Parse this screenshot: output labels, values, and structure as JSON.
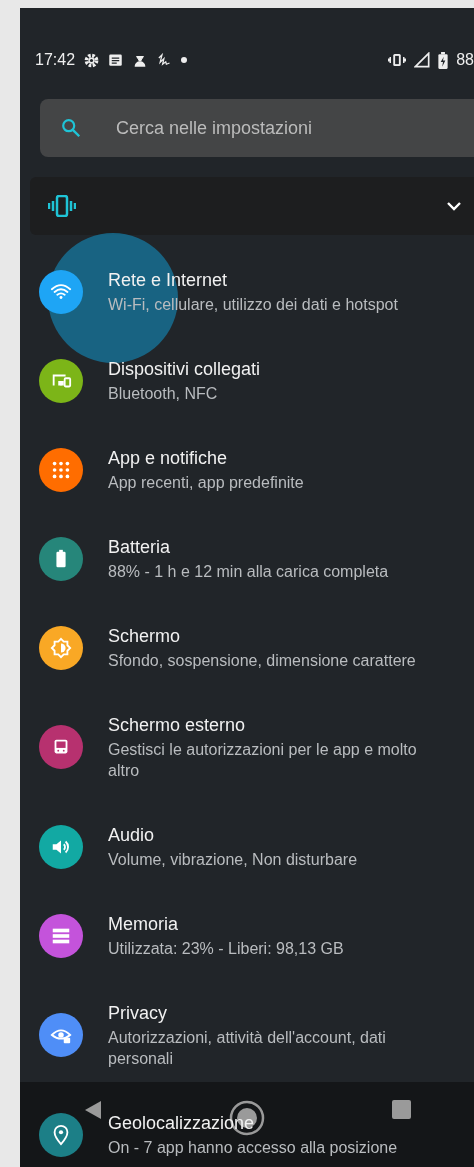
{
  "status_bar": {
    "time": "17:42",
    "battery": "88"
  },
  "search": {
    "placeholder": "Cerca nelle impostazioni"
  },
  "sound_mode_bar": {
    "expanded": false
  },
  "items": [
    {
      "title": "Rete e Internet",
      "subtitle": "Wi-Fi, cellulare, utilizzo dei dati e hotspot",
      "color": "#1ea5f5",
      "pressed": true
    },
    {
      "title": "Dispositivi collegati",
      "subtitle": "Bluetooth, NFC",
      "color": "#7cb518",
      "pressed": false
    },
    {
      "title": "App e notifiche",
      "subtitle": "App recenti, app predefinite",
      "color": "#ff6d00",
      "pressed": false
    },
    {
      "title": "Batteria",
      "subtitle": "88% - 1 h e 12 min alla carica completa",
      "color": "#26867a",
      "pressed": false
    },
    {
      "title": "Schermo",
      "subtitle": "Sfondo, sospensione, dimensione carattere",
      "color": "#f9a825",
      "pressed": false
    },
    {
      "title": "Schermo esterno",
      "subtitle": "Gestisci le autorizzazioni per le app e molto altro",
      "color": "#b7316f",
      "pressed": false
    },
    {
      "title": "Audio",
      "subtitle": "Volume, vibrazione, Non disturbare",
      "color": "#12a9a3",
      "pressed": false
    },
    {
      "title": "Memoria",
      "subtitle": "Utilizzata: 23% - Liberi: 98,13 GB",
      "color": "#c453db",
      "pressed": false
    },
    {
      "title": "Privacy",
      "subtitle": "Autorizzazioni, attività dell'account, dati personali",
      "color": "#4f8ef7",
      "pressed": false
    },
    {
      "title": "Geolocalizzazione",
      "subtitle": "On - 7 app hanno accesso alla posizione",
      "color": "#1c7f87",
      "pressed": false
    }
  ]
}
